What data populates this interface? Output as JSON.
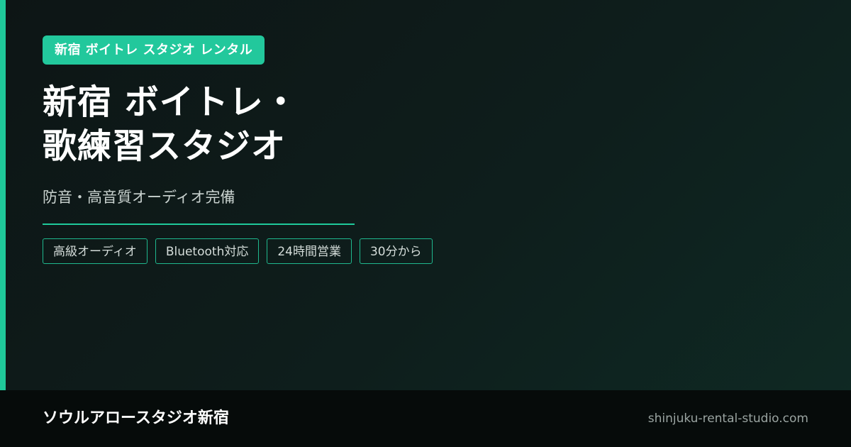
{
  "badge": "新宿 ボイトレ スタジオ レンタル",
  "title": {
    "line1": "新宿 ボイトレ・",
    "line2": "歌練習スタジオ"
  },
  "subtitle": "防音・高音質オーディオ完備",
  "tags": [
    "高級オーディオ",
    "Bluetooth対応",
    "24時間営業",
    "30分から"
  ],
  "footer": {
    "name": "ソウルアロースタジオ新宿",
    "url": "shinjuku-rental-studio.com"
  },
  "colors": {
    "accent": "#1fc99a",
    "badge_bg": "#22c89c",
    "background": "#0e1e1c",
    "footer_bg": "#060b0a"
  }
}
